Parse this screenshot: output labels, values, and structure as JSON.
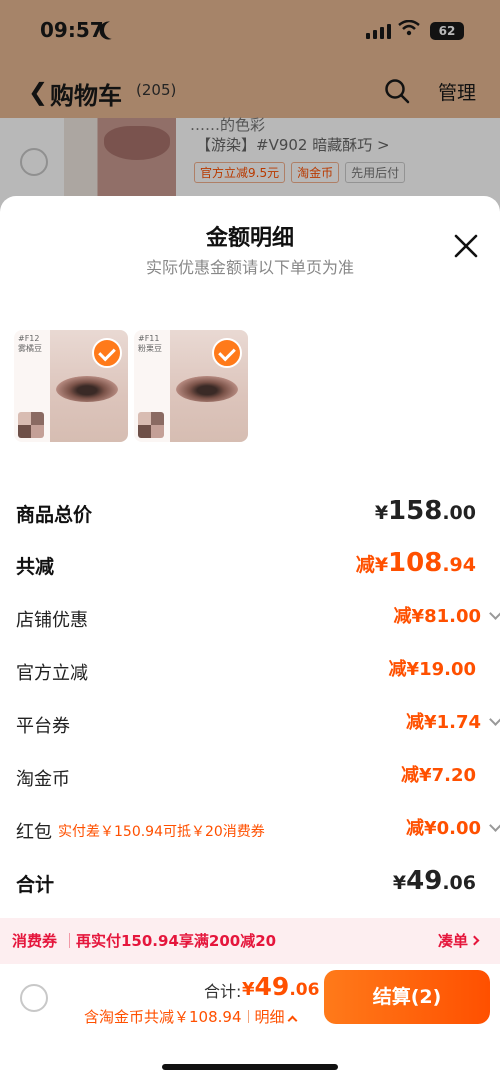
{
  "status": {
    "time": "09:57",
    "battery": "62"
  },
  "nav": {
    "title": "购物车",
    "count": "(205)",
    "manage": "管理"
  },
  "cart_item": {
    "title_fragment": "……的色彩",
    "variant": "【游染】#V902 暗藏酥巧 >",
    "tags": [
      "官方立减9.5元",
      "淘金币",
      "先用后付"
    ]
  },
  "sheet": {
    "title": "金额明细",
    "subtitle": "实际优惠金额请以下单页为准",
    "products": [
      {
        "label": "#F12\n雾橘豆",
        "checked": true
      },
      {
        "label": "#F11\n粉栗豆",
        "checked": true
      }
    ],
    "lines": [
      {
        "label": "商品总价",
        "currency": "¥",
        "int": "158",
        "dec": ".00",
        "prefix": ""
      },
      {
        "label": "共减",
        "currency": "¥",
        "int": "108",
        "dec": ".94",
        "prefix": "减"
      },
      {
        "label": "店铺优惠",
        "amount": "81.00",
        "prefix": "减¥"
      },
      {
        "label": "官方立减",
        "amount": "19.00",
        "prefix": "减¥"
      },
      {
        "label": "平台券",
        "amount": "1.74",
        "prefix": "减¥"
      },
      {
        "label": "淘金币",
        "amount": "7.20",
        "prefix": "减¥"
      },
      {
        "label": "红包",
        "note": "实付差￥150.94可抵￥20消费券",
        "amount": "0.00",
        "prefix": "减¥"
      },
      {
        "label": "合计",
        "currency": "¥",
        "int": "49",
        "dec": ".06",
        "prefix": ""
      }
    ]
  },
  "coupon": {
    "label": "消费券",
    "text": "再实付150.94享满200减20",
    "action": "凑单"
  },
  "bottom": {
    "total_label": "合计:",
    "total_currency": "¥",
    "total_int": "49",
    "total_dec": ".06",
    "save_text": "含淘金币共减￥108.94",
    "detail_label": "明细",
    "checkout": "结算(2)"
  },
  "colors": {
    "accent": "#ff5000",
    "coupon_red": "#e5163c",
    "header_bg": "#e6b892"
  }
}
